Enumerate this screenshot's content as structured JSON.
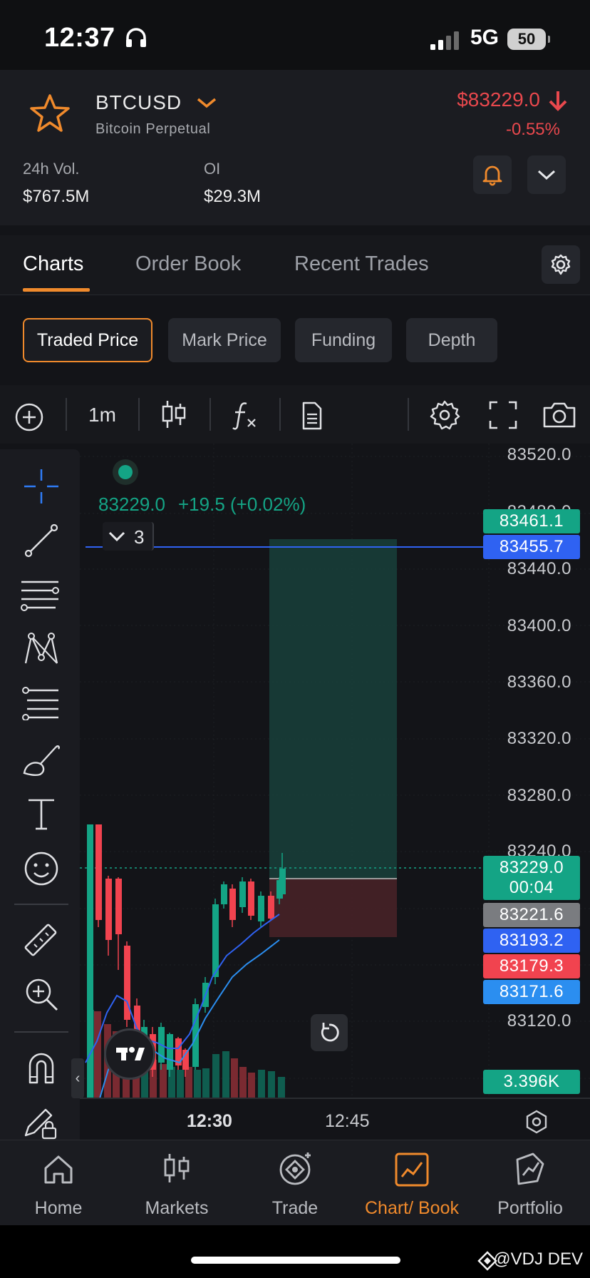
{
  "status_bar": {
    "time": "12:37",
    "network": "5G",
    "battery": "50"
  },
  "header": {
    "symbol": "BTCUSD",
    "subtitle": "Bitcoin Perpetual",
    "price": "$83229.0",
    "change_pct": "-0.55%",
    "vol_label": "24h Vol.",
    "vol_value": "$767.5M",
    "oi_label": "OI",
    "oi_value": "$29.3M"
  },
  "tabs": [
    {
      "label": "Charts",
      "active": true
    },
    {
      "label": "Order Book",
      "active": false
    },
    {
      "label": "Recent Trades",
      "active": false
    }
  ],
  "chips": [
    {
      "label": "Traded Price",
      "active": true
    },
    {
      "label": "Mark Price",
      "active": false
    },
    {
      "label": "Funding",
      "active": false
    },
    {
      "label": "Depth",
      "active": false
    }
  ],
  "toolbar": {
    "timeframe": "1m"
  },
  "chart": {
    "legend_price": "83229.0",
    "legend_change": "+19.5 (+0.02%)",
    "indicators_collapsed_count": "3",
    "price_axis": [
      "83520.0",
      "83480.0",
      "83440.0",
      "83400.0",
      "83360.0",
      "83320.0",
      "83280.0",
      "83240.0",
      "83120.0"
    ],
    "time_axis": [
      "12:30",
      "12:45"
    ],
    "tags": {
      "t1": "83461.1",
      "t2": "83455.7",
      "last_price": "83229.0",
      "countdown": "00:04",
      "t4": "83221.6",
      "t5": "83193.2",
      "t6": "83179.3",
      "t7": "83171.6",
      "volume": "3.396K"
    },
    "colors": {
      "up": "#14a485",
      "down": "#f1434f",
      "blue": "#2f62f2",
      "gray": "#7a7c80",
      "lightblue": "#2b8ef0"
    }
  },
  "bottom_nav": [
    {
      "label": "Home",
      "icon": "home-icon",
      "active": false
    },
    {
      "label": "Markets",
      "icon": "markets-icon",
      "active": false
    },
    {
      "label": "Trade",
      "icon": "trade-icon",
      "active": false
    },
    {
      "label": "Chart/ Book",
      "icon": "chart-icon",
      "active": true
    },
    {
      "label": "Portfolio",
      "icon": "portfolio-icon",
      "active": false
    }
  ],
  "watermark": "@VDJ DEV"
}
